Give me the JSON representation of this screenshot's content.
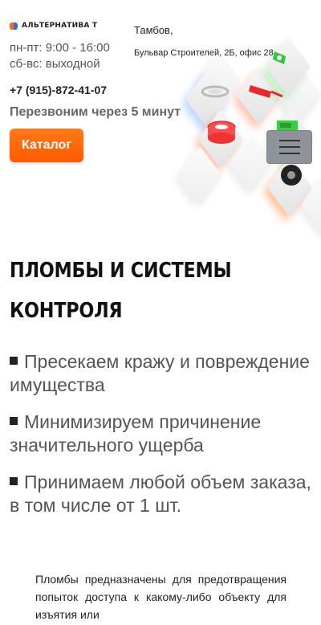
{
  "header": {
    "logo_text": "АЛЬТЕРНАТИВА Т",
    "hours": [
      "пн-пт: 9:00 - 16:00",
      "сб-вс: выходной"
    ],
    "city": "Тамбов,",
    "address": "Бульвар Строителей, 2Б, офис 28",
    "phone": "+7 (915)-872-41-07",
    "callback": "Перезвоним через 5 минут",
    "catalog_label": "Каталог",
    "menu_icon": "hamburger-icon"
  },
  "hero": {
    "title_lines": [
      "ПЛОМБЫ И СИСТЕМЫ",
      "КОНТРОЛЯ"
    ],
    "benefits": [
      "Пресекаем кражу и повреждение имущества",
      "Минимизируем причинение значительного ущерба",
      "Принимаем любой объем заказа, в том числе от 1 шт."
    ]
  },
  "description": "Пломбы предназначены для предотвращения попыток доступа к какому-либо объекту для изъятия или",
  "colors": {
    "accent": "#ff6a13",
    "brand_blue": "#2b6fd9",
    "menu_bg": "#8e949a"
  }
}
